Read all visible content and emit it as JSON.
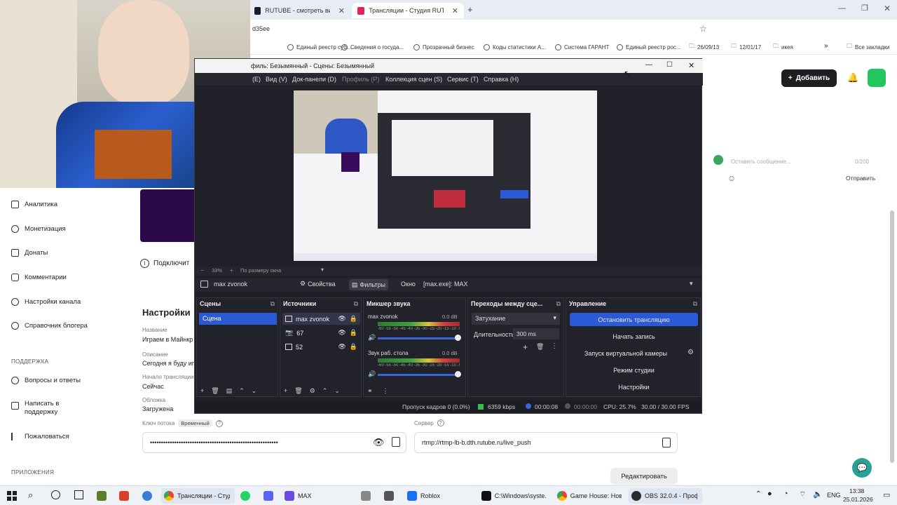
{
  "browser": {
    "tabs": [
      {
        "label": "RUTUBE - смотреть видео он",
        "active": false
      },
      {
        "label": "Трансляции - Студия RUTUBE",
        "active": true
      }
    ],
    "address_fragment": "d35ee",
    "bookmarks": [
      "Единый реестр суб...",
      "Сведения о госуда...",
      "Прозрачный бизнес",
      "Коды статистики А...",
      "Система ГАРАНТ",
      "Единый реестр рос...",
      "26/09/13",
      "12/01/17",
      "икея",
      "Все закладки"
    ]
  },
  "rutube": {
    "add_button": "Добавить",
    "sidebar": {
      "items": [
        "Аналитика",
        "Монетизация",
        "Донаты",
        "Комментарии",
        "Настройки канала",
        "Справочник блогера"
      ],
      "support_head": "ПОДДЕРЖКА",
      "support_items": [
        "Вопросы и ответы",
        "Написать в поддержку",
        "Пожаловаться"
      ],
      "apps_head": "ПРИЛОЖЕНИЯ"
    },
    "connect_text": "Подключит",
    "settings_title": "Настройки",
    "fields": [
      {
        "label": "Название",
        "value": "Играем в Майнкр"
      },
      {
        "label": "Описание",
        "value": "Сегодня я буду иг"
      },
      {
        "label": "Начало трансляции",
        "value": "Сейчас"
      },
      {
        "label": "Обложка",
        "value": "Загружена"
      }
    ],
    "stream_key_label": "Ключ потока",
    "stream_key_badge": "Временный",
    "stream_key_value": "••••••••••••••••••••••••••••••••••••••••••••••••••••••••••",
    "server_label": "Сервер",
    "server_value": "rtmp://rtmp-lb-b.dth.rutube.ru/live_push",
    "edit_button": "Редактировать",
    "chat": {
      "placeholder": "Оставить сообщение...",
      "counter": "0/200",
      "send": "Отправить"
    }
  },
  "obs": {
    "title": "филь: Безымянный - Сцены: Безымянный",
    "menu": [
      "(E)",
      "Вид (V)",
      "Док-панели (D)",
      "Профиль (P)",
      "Коллекция сцен (S)",
      "Сервис (T)",
      "Справка (H)"
    ],
    "preview_zoom": "33%",
    "preview_fit": "По размеру окна",
    "source_bar": {
      "name": "max zvonok",
      "properties": "Свойства",
      "filters": "Фильтры",
      "window_label": "Окно",
      "window_value": "[max.exe]: MAX"
    },
    "scenes": {
      "title": "Сцены",
      "items": [
        "Сцена"
      ]
    },
    "sources": {
      "title": "Источники",
      "items": [
        "max zvonok",
        "67",
        "52"
      ]
    },
    "mixer": {
      "title": "Микшер звука",
      "channels": [
        {
          "name": "max zvonok",
          "db": "0.0 dB"
        },
        {
          "name": "Звук раб. стола",
          "db": "0.0 dB"
        }
      ],
      "scale": "-60 -55 -50 -45 -40 -35 -30 -25 -20 -15 -10 -5 0"
    },
    "transitions": {
      "title": "Переходы между сце...",
      "type": "Затухание",
      "duration_label": "Длительность",
      "duration_value": "300 ms"
    },
    "controls": {
      "title": "Управление",
      "buttons": [
        "Остановить трансляцию",
        "Начать запись",
        "Запуск виртуальной камеры",
        "Режим студии",
        "Настройки"
      ]
    },
    "status": {
      "dropped": "Пропуск кадров 0 (0.0%)",
      "bitrate": "6359 kbps",
      "live_time": "00:00:08",
      "rec_time": "00:00:00",
      "cpu": "CPU: 25.7%",
      "fps": "30.00 / 30.00 FPS"
    }
  },
  "taskbar": {
    "items": [
      "Трансляции - Студ...",
      "MAX",
      "Roblox",
      "C:\\Windows\\syste...",
      "Game House: Ново...",
      "OBS 32.0.4 - Проф..."
    ],
    "lang": "ENG",
    "time": "13:38",
    "date": "25.01.2026"
  }
}
